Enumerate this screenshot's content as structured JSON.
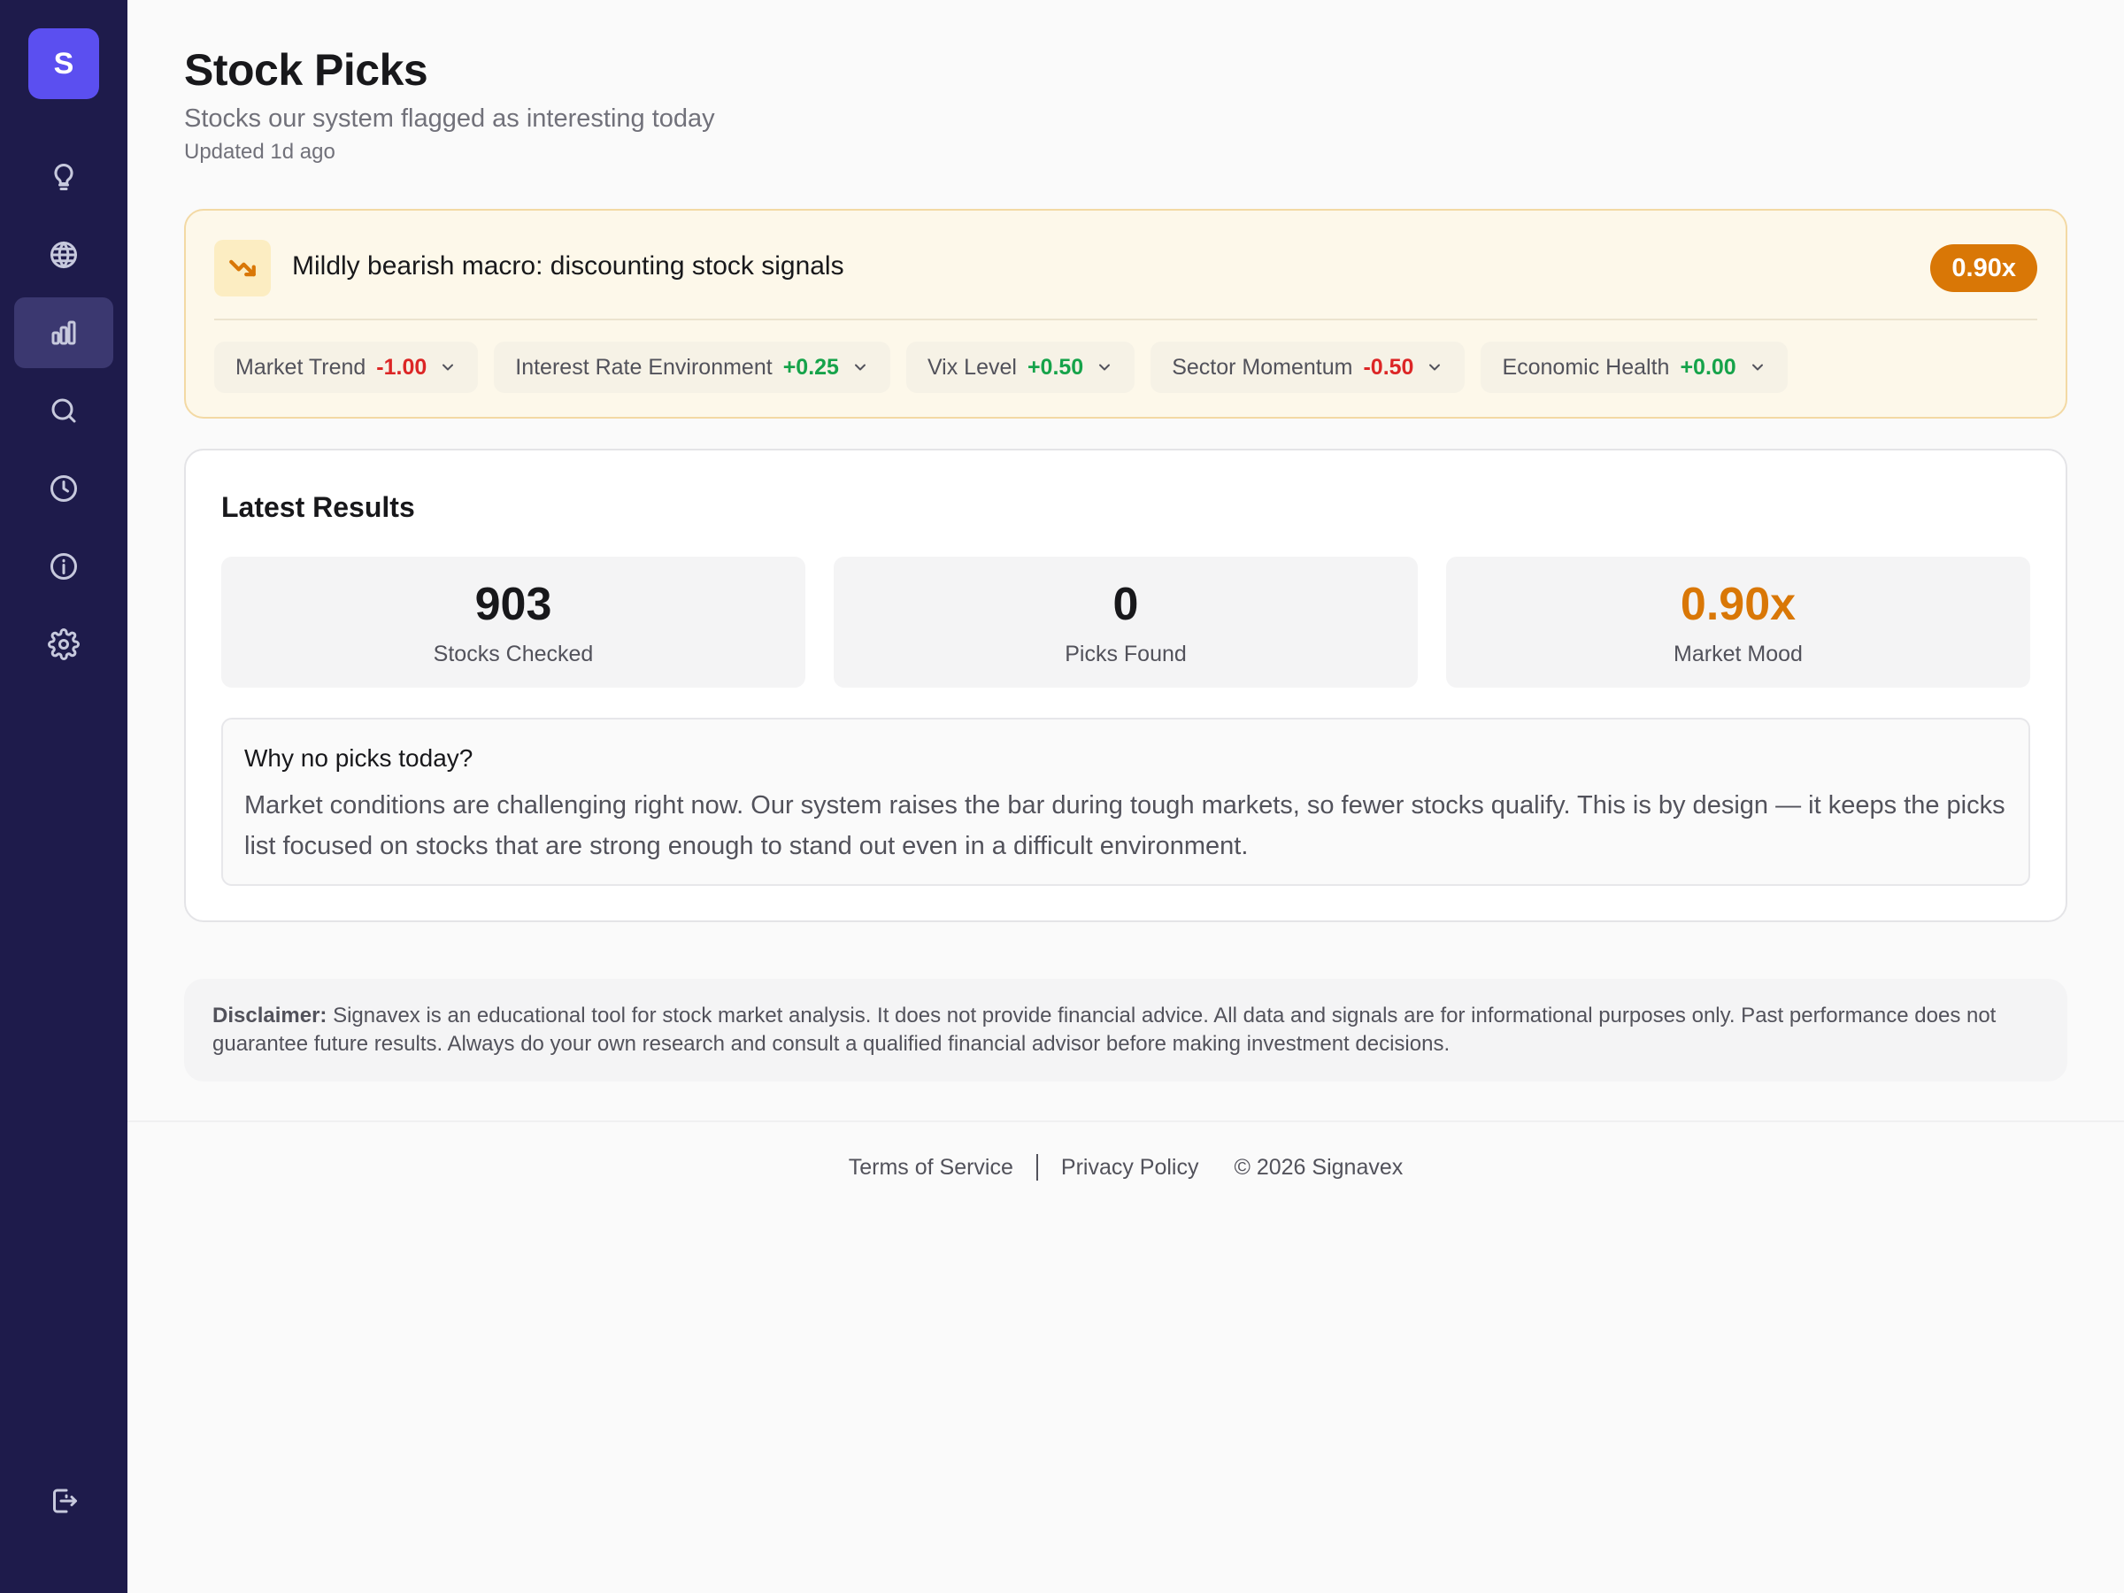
{
  "sidebar": {
    "logo_letter": "S",
    "items": [
      {
        "icon": "lightbulb-icon"
      },
      {
        "icon": "globe-icon"
      },
      {
        "icon": "bar-chart-icon",
        "active": true
      },
      {
        "icon": "search-icon"
      },
      {
        "icon": "clock-icon"
      },
      {
        "icon": "info-icon"
      },
      {
        "icon": "gear-icon"
      }
    ],
    "logout_icon": "logout-icon"
  },
  "header": {
    "title": "Stock Picks",
    "subtitle": "Stocks our system flagged as interesting today",
    "updated": "Updated 1d ago"
  },
  "macro": {
    "icon": "trending-down-icon",
    "headline": "Mildly bearish macro: discounting stock signals",
    "multiplier": "0.90x",
    "factors": [
      {
        "label": "Market Trend",
        "value": "-1.00",
        "sign": "neg"
      },
      {
        "label": "Interest Rate Environment",
        "value": "+0.25",
        "sign": "pos"
      },
      {
        "label": "Vix Level",
        "value": "+0.50",
        "sign": "pos"
      },
      {
        "label": "Sector Momentum",
        "value": "-0.50",
        "sign": "neg"
      },
      {
        "label": "Economic Health",
        "value": "+0.00",
        "sign": "pos"
      }
    ]
  },
  "results": {
    "title": "Latest Results",
    "stats": [
      {
        "value": "903",
        "label": "Stocks Checked"
      },
      {
        "value": "0",
        "label": "Picks Found"
      },
      {
        "value": "0.90x",
        "label": "Market Mood"
      }
    ],
    "why_title": "Why no picks today?",
    "why_body": "Market conditions are challenging right now. Our system raises the bar during tough markets, so fewer stocks qualify. This is by design — it keeps the picks list focused on stocks that are strong enough to stand out even in a difficult environment."
  },
  "disclaimer": {
    "label": "Disclaimer:",
    "text": "Signavex is an educational tool for stock market analysis. It does not provide financial advice. All data and signals are for informational purposes only. Past performance does not guarantee future results. Always do your own research and consult a qualified financial advisor before making investment decisions."
  },
  "footer": {
    "terms": "Terms of Service",
    "privacy": "Privacy Policy",
    "copyright": "© 2026 Signavex"
  },
  "colors": {
    "sidebar_bg": "#1e1b4b",
    "logo_bg": "#5b4ff0",
    "accent_amber": "#d97706",
    "negative": "#dc2626",
    "positive": "#16a34a"
  }
}
